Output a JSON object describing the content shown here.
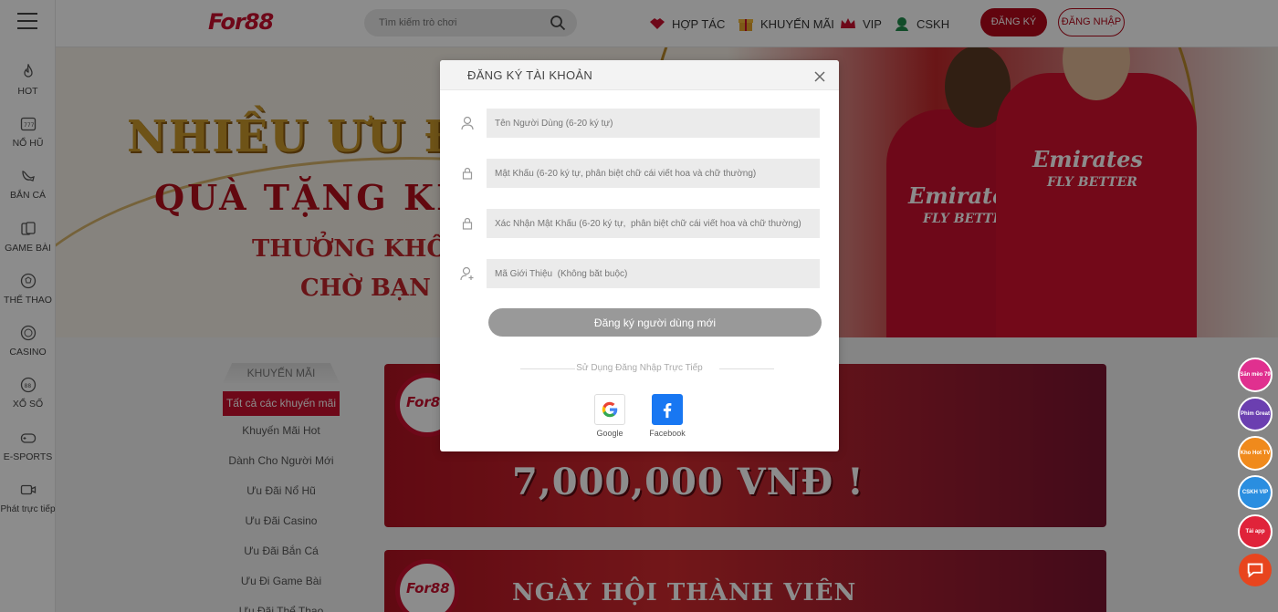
{
  "sidebar": {
    "items": [
      {
        "label": "HOT",
        "icon": "fire-icon"
      },
      {
        "label": "NỔ HŨ",
        "icon": "slot-machine-icon"
      },
      {
        "label": "BẮN CÁ",
        "icon": "fish-icon"
      },
      {
        "label": "GAME BÀI",
        "icon": "cards-icon"
      },
      {
        "label": "THỂ THAO",
        "icon": "soccer-ball-icon"
      },
      {
        "label": "CASINO",
        "icon": "casino-chip-icon"
      },
      {
        "label": "XỔ SỐ",
        "icon": "lottery-ball-icon"
      },
      {
        "label": "E-SPORTS",
        "icon": "gamepad-icon"
      },
      {
        "label": "Phát trực tiếp",
        "icon": "video-camera-icon"
      }
    ]
  },
  "header": {
    "logo": "For88",
    "search_placeholder": "Tìm kiếm trò chơi",
    "nav": [
      {
        "label": "HỢP TÁC",
        "icon": "handshake-icon"
      },
      {
        "label": "KHUYẾN MÃI",
        "icon": "gift-icon"
      },
      {
        "label": "VIP",
        "icon": "crown-icon"
      },
      {
        "label": "CSKH",
        "icon": "support-agent-icon"
      }
    ],
    "register_label": "ĐĂNG KÝ",
    "login_label": "ĐĂNG NHẬP"
  },
  "hero": {
    "line1": "NHIỀU ƯU ĐÃ",
    "line2": "QUÀ TẶNG KHỦ",
    "line3": "THƯỞNG KHÔNG",
    "line4": "CHỜ BẠN ĐI",
    "jersey1": "Emirates",
    "jersey1b": "FLY BETTER",
    "jersey2": "Emirates",
    "jersey2b": "FLY BETTER"
  },
  "promo_menu": {
    "heading": "KHUYẾN MÃI",
    "items": [
      {
        "label": "Tất cả các khuyến mãi",
        "active": true
      },
      {
        "label": "Khuyến Mãi Hot",
        "active": false
      },
      {
        "label": "Dành Cho Người Mới",
        "active": false
      },
      {
        "label": "Ưu Đãi Nổ Hũ",
        "active": false
      },
      {
        "label": "Ưu Đãi Casino",
        "active": false
      },
      {
        "label": "Ưu Đãi Bắn Cá",
        "active": false
      },
      {
        "label": "Ưu Đi Game Bài",
        "active": false
      },
      {
        "label": "Ưu Đãi Thể Thao",
        "active": false
      }
    ]
  },
  "banners": {
    "b1_logo": "For88",
    "b1_amount": "7,000,000 VNĐ !",
    "b2_logo": "For88",
    "b2_title": "NGÀY HỘI THÀNH VIÊN"
  },
  "float_icons": [
    {
      "label": "Săn mèo 79",
      "color": "#e0308f"
    },
    {
      "label": "Phim Great",
      "color": "#6b3fb0"
    },
    {
      "label": "Kho Hot TV",
      "color": "#f08a1c"
    },
    {
      "label": "CSKH VIP",
      "color": "#2a8ee0"
    },
    {
      "label": "Tải app",
      "color": "#e0233a"
    },
    {
      "label": "",
      "color": "#e8451e"
    }
  ],
  "modal": {
    "title": "ĐĂNG KÝ TÀI KHOẢN",
    "fields": {
      "username_placeholder": "Tên Người Dùng (6-20 ký tự)",
      "password_placeholder": "Mật Khẩu (6-20 ký tự, phân biệt chữ cái viết hoa và chữ thường)",
      "confirm_placeholder": "Xác Nhận Mật Khẩu (6-20 ký tự,  phân biệt chữ cái viết hoa và chữ thường)",
      "referral_placeholder": "Mã Giới Thiệu  (Không bắt buộc)"
    },
    "submit_label": "Đăng ký người dùng mới",
    "divider_text": "Sử Dụng Đăng Nhập Trực Tiếp",
    "social": [
      {
        "label": "Google",
        "icon": "google-icon"
      },
      {
        "label": "Facebook",
        "icon": "facebook-icon"
      }
    ]
  },
  "colors": {
    "brand_red": "#b3091a",
    "overlay": "rgba(0,0,0,0.45)",
    "submit_disabled": "#999999"
  }
}
